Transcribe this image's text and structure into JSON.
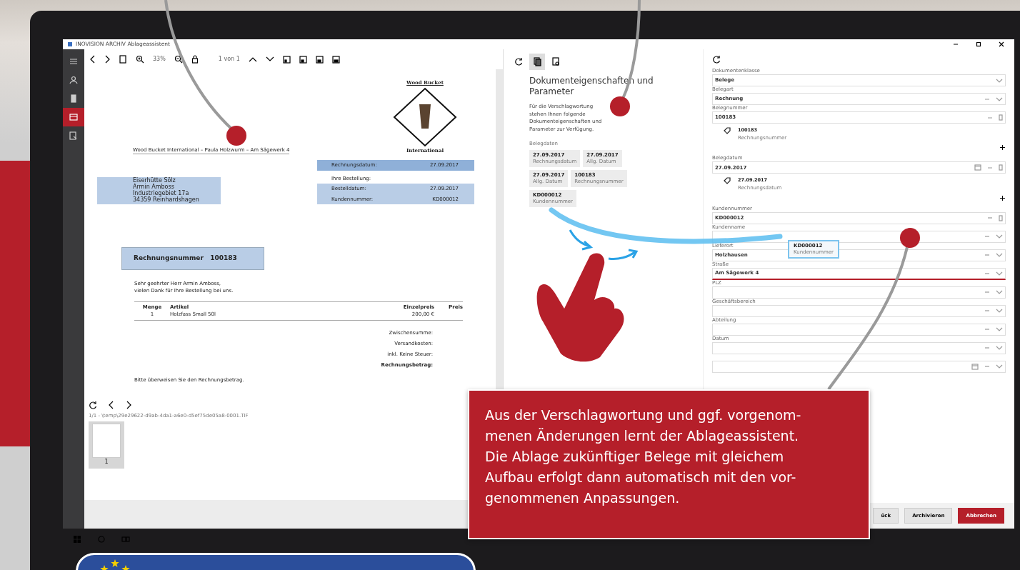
{
  "window": {
    "title": "INOVISION ARCHIV Ablageassistent"
  },
  "sidebar": {
    "items": [
      {
        "kind": "menu",
        "selected": false
      },
      {
        "kind": "user",
        "selected": false
      },
      {
        "kind": "document",
        "selected": false
      },
      {
        "kind": "folder",
        "selected": true
      },
      {
        "kind": "import",
        "selected": false
      }
    ]
  },
  "viewer": {
    "zoom": "33%",
    "page": "1 von 1"
  },
  "document": {
    "logo_top": "Wood Bucket",
    "logo_bottom": "International",
    "sender_line": "Wood Bucket International – Paula Holzwurm – Am Sägewerk 4",
    "recipient": {
      "lines": [
        "Eiserhütte Sölz",
        "Armin Amboss",
        "Industriegebiet 17a",
        "34359 Reinhardshagen"
      ],
      "highlighted": true
    },
    "info": [
      {
        "label": "Rechnungsdatum:",
        "value": "27.09.2017",
        "highlighted": true
      },
      {
        "label": "Ihre Bestellung:",
        "highlighted": false
      },
      {
        "label": "Bestelldatum:",
        "value": "27.09.2017",
        "highlighted": true
      },
      {
        "label": "Kundennummer:",
        "value": "KD000012",
        "highlighted": true
      }
    ],
    "invoice_number": {
      "label": "Rechnungsnummer",
      "value": "100183",
      "highlighted": true
    },
    "greeting": [
      "Sehr geehrter Herr Armin Amboss,",
      "vielen Dank für Ihre Bestellung bei uns."
    ],
    "table": {
      "columns": [
        "Menge",
        "Artikel",
        "Einzelpreis",
        "Preis"
      ],
      "rows": [
        [
          "1",
          "Holzfass Small 50l",
          "200,00 €"
        ]
      ]
    },
    "totals": [
      "Zwischensumme:",
      "Versandkosten:",
      "inkl. Keine Steuer:",
      "Rechnungsbetrag:"
    ],
    "closing": "Bitte überweisen Sie den Rechnungsbetrag."
  },
  "thumbnails": {
    "path": "1/1 - \\temp\\29e29622-d9ab-4da1-a6e0-d5ef75de05a8-0001.TIF",
    "pages": [
      {
        "label": "1",
        "selected": true
      }
    ]
  },
  "properties": {
    "tools": [
      {
        "kind": "refresh",
        "selected": false
      },
      {
        "kind": "pages",
        "selected": true
      },
      {
        "kind": "document",
        "selected": false
      }
    ],
    "title": "Dokumenteigenschaften und Parameter",
    "description": "Für die Verschlagwortung stehen Ihnen folgende Dokumenteigenschaften und Parameter zur Verfügung.",
    "group_label": "Belegdaten",
    "chips": [
      {
        "value": "27.09.2017",
        "label": "Rechnungsdatum"
      },
      {
        "value": "27.09.2017",
        "label": "Allg. Datum"
      },
      {
        "value": "27.09.2017",
        "label": "Allg. Datum"
      },
      {
        "value": "100183",
        "label": "Rechnungsnummer"
      },
      {
        "value": "KD000012",
        "label": "Kundennummer"
      }
    ]
  },
  "form": {
    "fields": [
      {
        "kind": "select",
        "label": "Dokumentenklasse",
        "value": "Belege",
        "active": false
      },
      {
        "kind": "combo",
        "label": "Belegart",
        "value": "Rechnung",
        "active": false
      },
      {
        "kind": "text",
        "label": "Belegnummer",
        "value": "100183",
        "active": false,
        "tags": [
          {
            "value": "100183",
            "label": "Rechnungsnummer"
          }
        ]
      },
      {
        "kind": "date",
        "label": "Belegdatum",
        "value": "27.09.2017",
        "active": false,
        "tags": [
          {
            "value": "27.09.2017",
            "label": "Rechnungsdatum"
          }
        ]
      },
      {
        "kind": "text",
        "label": "Kundennummer",
        "value": "KD000012",
        "active": false
      },
      {
        "kind": "combo",
        "label": "Kundenname",
        "active": false
      },
      {
        "kind": "combo",
        "label": "Lieferort",
        "value": "Holzhausen",
        "active": false
      },
      {
        "kind": "combo",
        "label": "Straße",
        "value": "Am Sägewerk 4",
        "active": true
      },
      {
        "kind": "combo",
        "label": "PLZ",
        "active": false
      },
      {
        "kind": "combo",
        "label": "Geschäftsbereich",
        "active": false
      },
      {
        "kind": "combo",
        "label": "Abteilung",
        "active": false
      },
      {
        "kind": "combo",
        "label": "Datum",
        "active": false
      },
      {
        "kind": "date",
        "active": false
      }
    ],
    "drag_chip": {
      "value": "KD000012",
      "label": "Kundennummer"
    }
  },
  "buttons": [
    {
      "label": "ück",
      "kind": "default"
    },
    {
      "label": "Archivieren",
      "kind": "default"
    },
    {
      "label": "Abbrechen",
      "kind": "primary"
    }
  ],
  "callout": {
    "lines": [
      "Aus der Verschlagwortung und ggf. vorgenom-",
      "menen Änderungen lernt der Ablageassistent.",
      "Die Ablage zukünftiger Belege mit gleichem",
      "Aufbau erfolgt dann automatisch mit den vor-",
      "genommenen Anpassungen."
    ]
  }
}
